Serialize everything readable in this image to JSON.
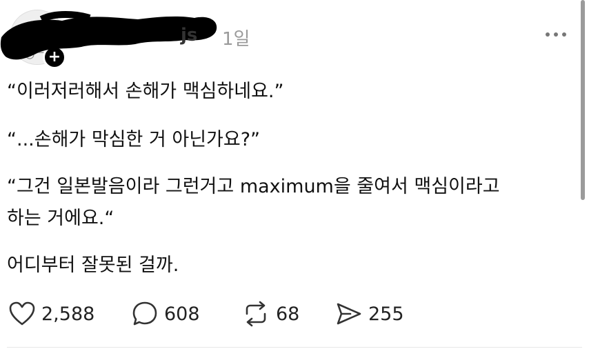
{
  "post": {
    "username": "js",
    "time": "1일",
    "lines": [
      "“이러저러해서 손해가 맥심하네요.”",
      "“...손해가 막심한 거 아닌가요?”",
      "“그건 일본발음이라 그런거고 maximum을 줄여서 맥심이라고",
      "하는 거에요.“",
      "어디부터 잘못된 걸까."
    ]
  },
  "actions": {
    "like_count": "2,588",
    "comment_count": "608",
    "repost_count": "68",
    "share_count": "255"
  },
  "icons": {
    "follow": "plus-icon",
    "more": "more-horizontal-icon",
    "like": "heart-icon",
    "comment": "speech-bubble-icon",
    "repost": "repost-arrows-icon",
    "share": "send-icon"
  },
  "colors": {
    "text": "#111111",
    "muted": "#9a9a9a",
    "redaction": "#000000",
    "badge": "#000000"
  }
}
